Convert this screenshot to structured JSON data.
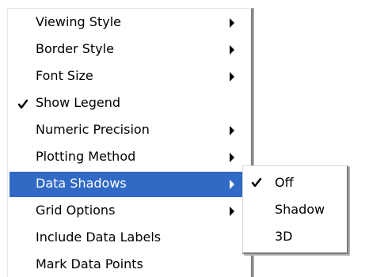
{
  "menu": {
    "items": [
      {
        "label": "Viewing Style",
        "has_submenu": true,
        "checked": false,
        "selected": false
      },
      {
        "label": "Border Style",
        "has_submenu": true,
        "checked": false,
        "selected": false
      },
      {
        "label": "Font Size",
        "has_submenu": true,
        "checked": false,
        "selected": false
      },
      {
        "label": "Show Legend",
        "has_submenu": false,
        "checked": true,
        "selected": false
      },
      {
        "label": "Numeric Precision",
        "has_submenu": true,
        "checked": false,
        "selected": false
      },
      {
        "label": "Plotting Method",
        "has_submenu": true,
        "checked": false,
        "selected": false
      },
      {
        "label": "Data Shadows",
        "has_submenu": true,
        "checked": false,
        "selected": true
      },
      {
        "label": "Grid Options",
        "has_submenu": true,
        "checked": false,
        "selected": false
      },
      {
        "label": "Include Data Labels",
        "has_submenu": false,
        "checked": false,
        "selected": false
      },
      {
        "label": "Mark Data Points",
        "has_submenu": false,
        "checked": false,
        "selected": false
      }
    ]
  },
  "submenu": {
    "items": [
      {
        "label": "Off",
        "checked": true
      },
      {
        "label": "Shadow",
        "checked": false
      },
      {
        "label": "3D",
        "checked": false
      }
    ]
  },
  "colors": {
    "selection_background": "#316ac5",
    "selection_text": "#ffffff",
    "menu_background": "#ffffff"
  },
  "icons": {
    "check": "checkmark-icon",
    "submenu_arrow": "submenu-arrow-icon"
  }
}
